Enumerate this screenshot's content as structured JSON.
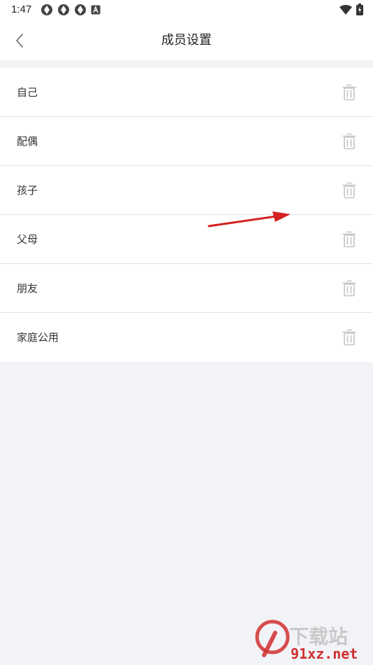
{
  "status_bar": {
    "time": "1:47",
    "icons_left": [
      "app-notification-icon",
      "app-notification-icon",
      "app-notification-icon",
      "a-icon"
    ],
    "icons_right": [
      "wifi-icon",
      "battery-icon"
    ]
  },
  "nav": {
    "title": "成员设置",
    "back_icon": "chevron-left-icon"
  },
  "members": [
    {
      "label": "自己"
    },
    {
      "label": "配偶"
    },
    {
      "label": "孩子"
    },
    {
      "label": "父母"
    },
    {
      "label": "朋友"
    },
    {
      "label": "家庭公用"
    }
  ],
  "watermark": {
    "logo_text": "下载站",
    "url": "91xz.net"
  },
  "colors": {
    "background": "#f2f3f7",
    "card": "#ffffff",
    "divider": "#e3e3e6",
    "trash_icon": "#c4c4c4",
    "annotation_arrow": "#d42020"
  }
}
